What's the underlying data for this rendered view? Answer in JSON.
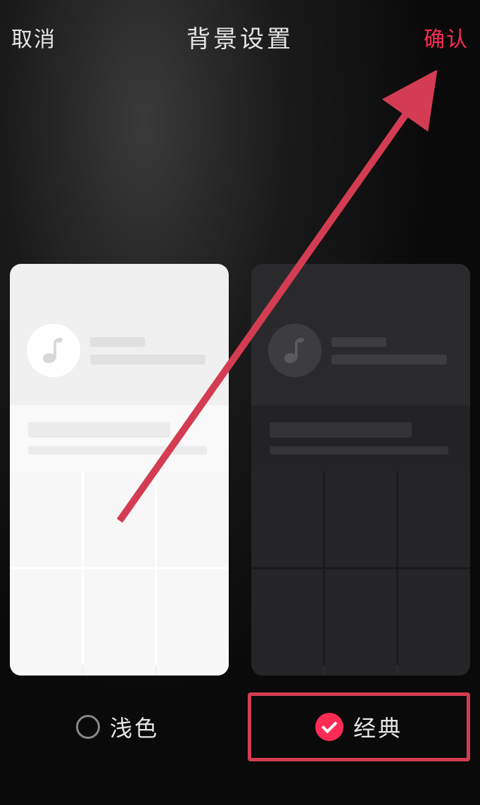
{
  "header": {
    "cancel": "取消",
    "title": "背景设置",
    "confirm": "确认"
  },
  "themes": {
    "light": {
      "label": "浅色",
      "selected": false
    },
    "dark": {
      "label": "经典",
      "selected": true
    }
  }
}
